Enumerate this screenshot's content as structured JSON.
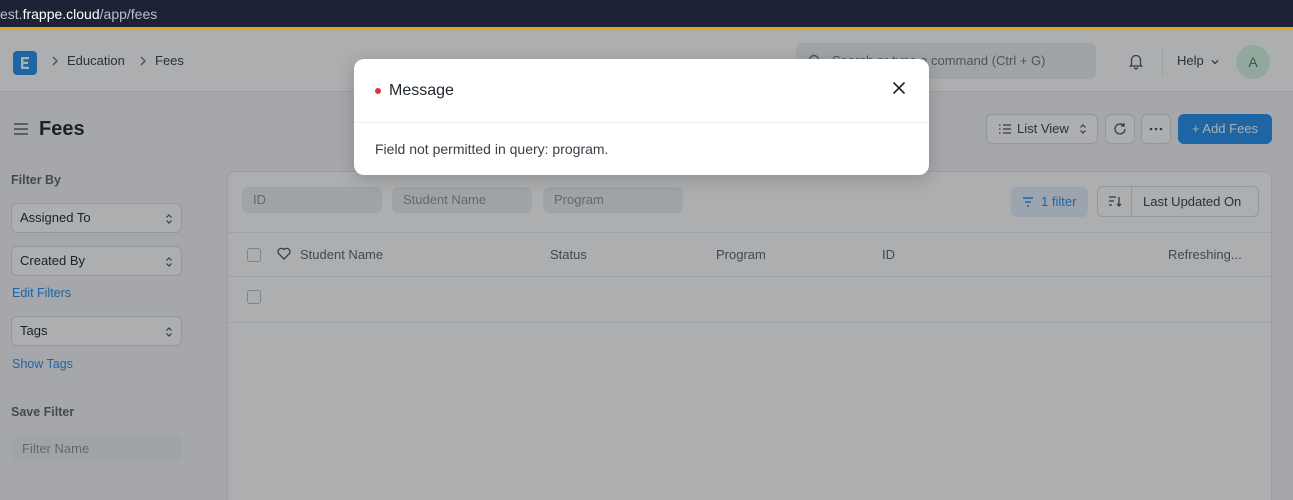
{
  "browser": {
    "url_prefix": "est.",
    "url_host": "frappe.cloud",
    "url_path": "/app/fees"
  },
  "navbar": {
    "breadcrumbs": [
      "Education",
      "Fees"
    ],
    "search_placeholder": "Search or type a command (Ctrl + G)",
    "help_label": "Help",
    "avatar_initial": "A"
  },
  "page": {
    "title": "Fees",
    "list_view_label": "List View",
    "add_label": "+ Add Fees"
  },
  "sidebar": {
    "filter_by_label": "Filter By",
    "assigned_to": "Assigned To",
    "created_by": "Created By",
    "edit_filters": "Edit Filters",
    "tags": "Tags",
    "show_tags": "Show Tags",
    "save_filter_label": "Save Filter",
    "filter_name_placeholder": "Filter Name"
  },
  "list": {
    "filter_inputs": [
      "ID",
      "Student Name",
      "Program"
    ],
    "filter_button": "1 filter",
    "sort_label": "Last Updated On",
    "columns": [
      "Student Name",
      "Status",
      "Program",
      "ID"
    ],
    "status_text": "Refreshing..."
  },
  "modal": {
    "title": "Message",
    "body": "Field not permitted in query: program."
  },
  "colors": {
    "primary": "#2490ef",
    "indicator_red": "#e03636"
  }
}
